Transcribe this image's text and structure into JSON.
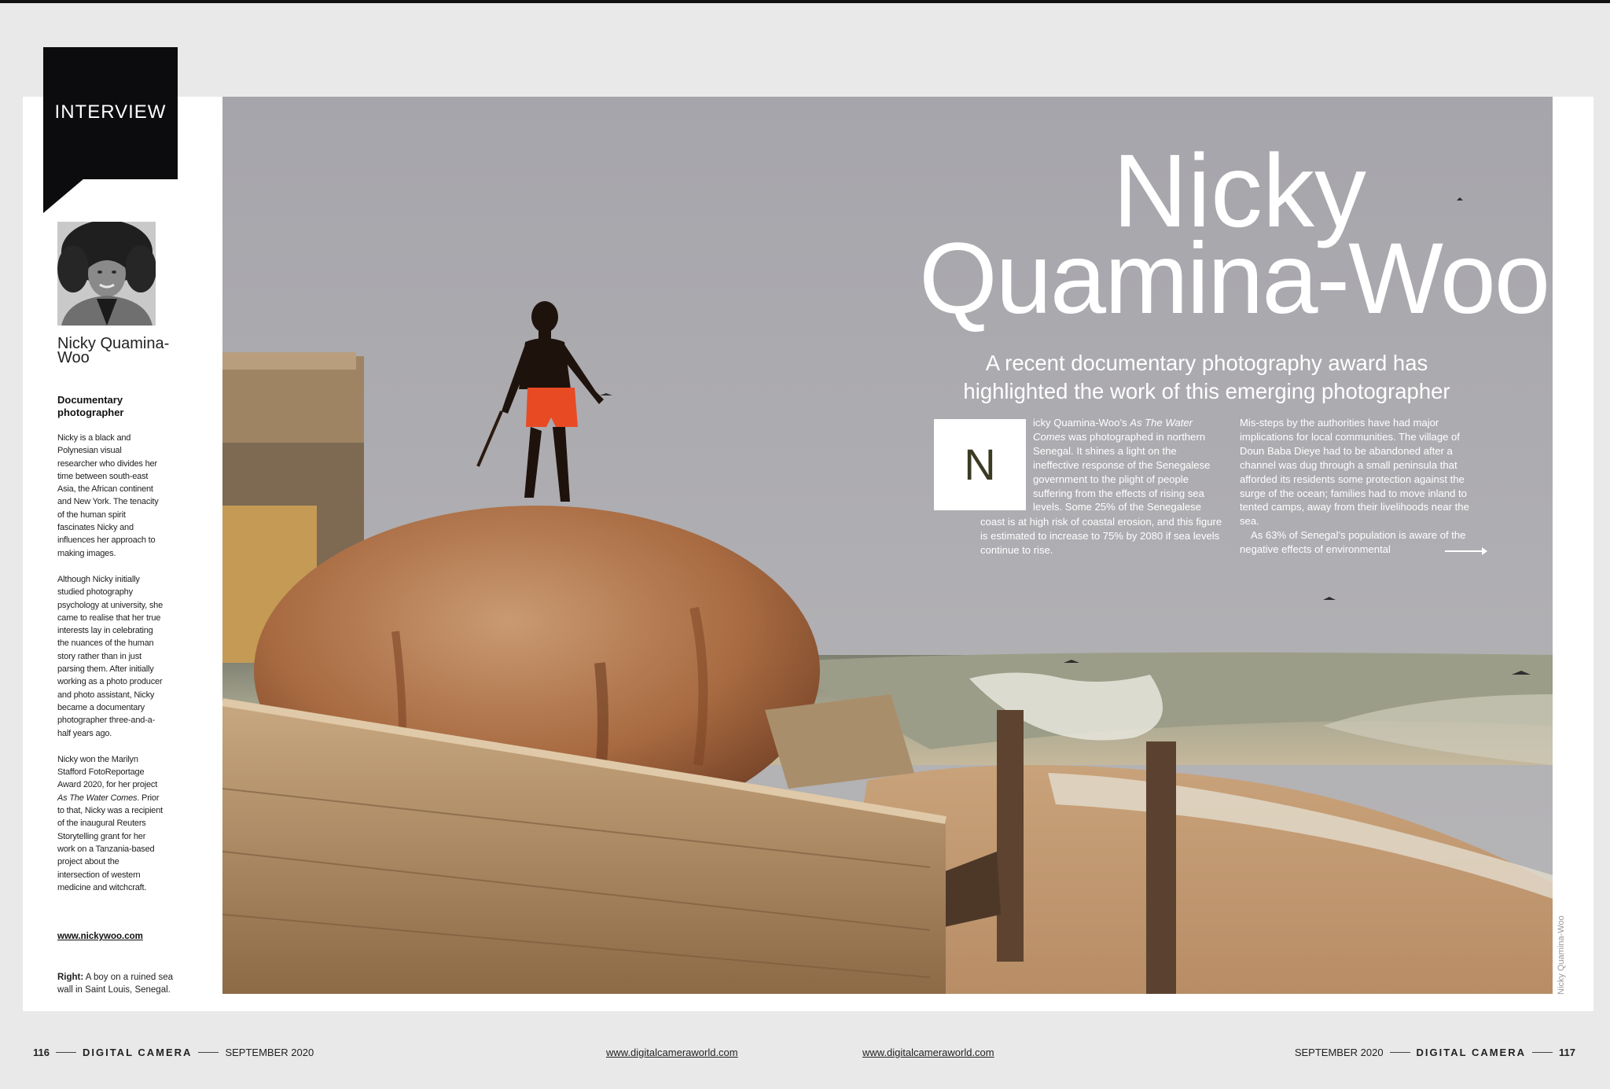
{
  "badge": {
    "label": "INTERVIEW"
  },
  "sidebar": {
    "name": "Nicky Quamina-Woo",
    "role": "Documentary photographer",
    "bio_p1": "Nicky is a black and Polynesian visual researcher who divides her time between south-east Asia, the African continent and New York. The tenacity of the human spirit fascinates Nicky and influences her approach to making images.",
    "bio_p2": "Although Nicky initially studied photography psychology at university, she came to realise that her true interests lay in celebrating the nuances of the human story rather than in just parsing them. After initially working as a photo producer and photo assistant, Nicky became a documentary photographer three-and-a-half years ago.",
    "bio_p3_a": "Nicky won the Marilyn Stafford FotoReportage Award 2020, for her project ",
    "bio_p3_title": "As The Water Comes",
    "bio_p3_b": ". Prior to that, Nicky was a recipient of the inaugural Reuters Storytelling grant for her work on a Tanzania-based project about the intersection of western medicine and witchcraft.",
    "website": "www.nickywoo.com",
    "caption_label": "Right:",
    "caption_text": " A boy on a ruined sea wall in Saint Louis, Senegal."
  },
  "article": {
    "title_line1": "Nicky",
    "title_line2": "Quamina-Woo",
    "standfirst_line1": "A recent documentary photography award has",
    "standfirst_line2": "highlighted the work of this emerging photographer",
    "dropcap": "N",
    "col1_a1": "icky Quamina-Woo’s ",
    "col1_title": "As The Water Comes",
    "col1_a2": " was photographed in northern Senegal. It shines a light on the ineffective response of the Senegalese government to the plight of people suffering from the effects of rising sea levels. Some 25% of the Senegalese",
    "col1_b": "coast is at high risk of coastal erosion, and this figure is estimated to increase to 75% by 2080 if sea levels continue to rise.",
    "col2_p1": "Mis-steps by the authorities have had major implications for local communities. The village of Doun Baba Dieye had to be abandoned after a channel was dug through a small peninsula that afforded its residents some protection against the surge of the ocean; families had to move inland to tented camps, away from their livelihoods near the sea.",
    "col2_p2": "As 63% of Senegal’s population is aware of the negative effects of environmental",
    "photo_credit": "Nicky Quamina-Woo"
  },
  "footer": {
    "left_page": "116",
    "magazine": "DIGITAL CAMERA",
    "date": "SEPTEMBER 2020",
    "website_left": "www.digitalcameraworld.com",
    "website_right": "www.digitalcameraworld.com",
    "right_page": "117"
  },
  "colors": {
    "ink": "#0c0c0e",
    "sky": "#a9a8ad",
    "rust": "#9c5a34",
    "sea": "#8e8c78"
  }
}
